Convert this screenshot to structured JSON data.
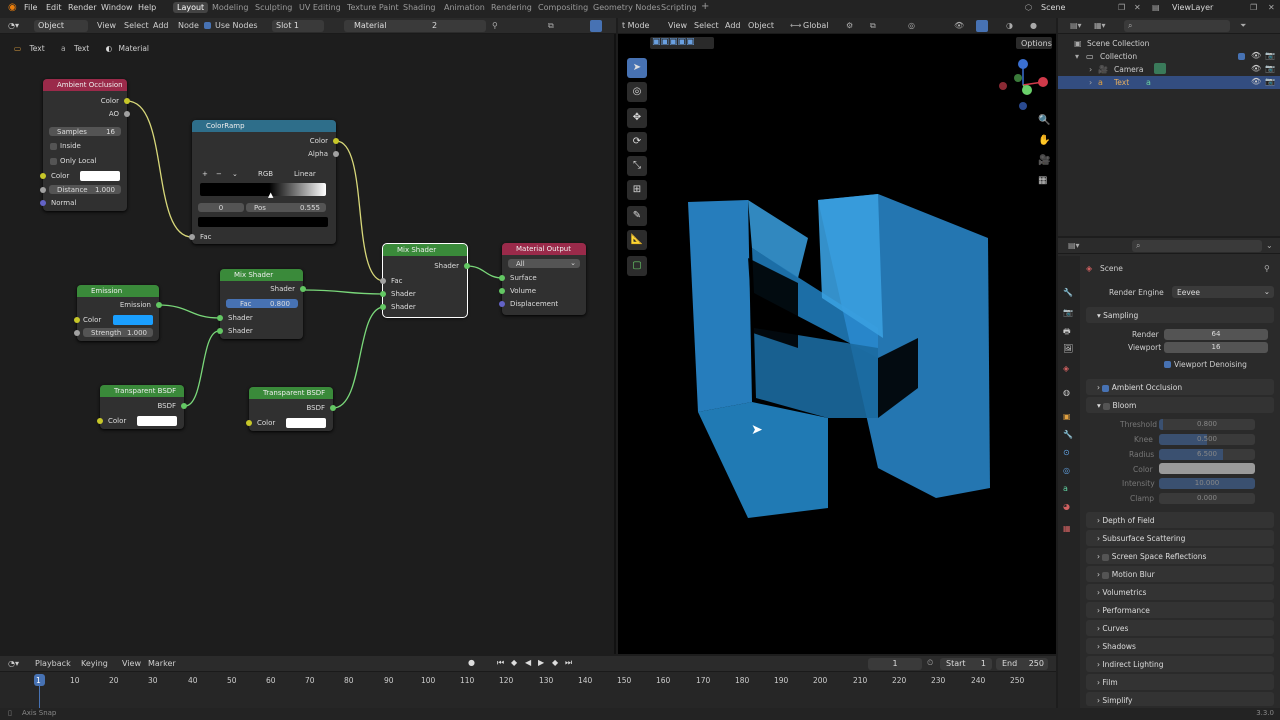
{
  "menu": [
    "File",
    "Edit",
    "Render",
    "Window",
    "Help"
  ],
  "workspaces": [
    "Layout",
    "Modeling",
    "Sculpting",
    "UV Editing",
    "Texture Paint",
    "Shading",
    "Animation",
    "Rendering",
    "Compositing",
    "Geometry Nodes",
    "Scripting"
  ],
  "scene_name": "Scene",
  "view_layer": "ViewLayer",
  "node_header": {
    "mode": "Object",
    "view": "View",
    "select": "Select",
    "add": "Add",
    "node": "Node",
    "use_nodes": "Use Nodes",
    "slot": "Slot 1",
    "material": "Material",
    "users": "2"
  },
  "breadcrumb": [
    "Text",
    "Text",
    "Material"
  ],
  "nodes": {
    "ao": {
      "title": "Ambient Occlusion",
      "color_out": "Color",
      "ao_out": "AO",
      "samples_label": "Samples",
      "samples": "16",
      "inside": "Inside",
      "only_local": "Only Local",
      "color_in": "Color",
      "distance_label": "Distance",
      "distance": "1.000",
      "normal": "Normal"
    },
    "ramp": {
      "title": "ColorRamp",
      "color_out": "Color",
      "alpha_out": "Alpha",
      "mode": "RGB",
      "interp": "Linear",
      "index": "0",
      "pos_label": "Pos",
      "pos": "0.555",
      "fac": "Fac"
    },
    "emission": {
      "title": "Emission",
      "out": "Emission",
      "color": "Color",
      "strength_label": "Strength",
      "strength": "1.000"
    },
    "mix1": {
      "title": "Mix Shader",
      "out": "Shader",
      "fac_label": "Fac",
      "fac": "0.800",
      "shader1": "Shader",
      "shader2": "Shader"
    },
    "mix2": {
      "title": "Mix Shader",
      "out": "Shader",
      "fac": "Fac",
      "shader1": "Shader",
      "shader2": "Shader"
    },
    "output": {
      "title": "Material Output",
      "target": "All",
      "surface": "Surface",
      "volume": "Volume",
      "displacement": "Displacement"
    },
    "tbsdf1": {
      "title": "Transparent BSDF",
      "out": "BSDF",
      "color": "Color"
    },
    "tbsdf2": {
      "title": "Transparent BSDF",
      "out": "BSDF",
      "color": "Color"
    }
  },
  "viewport_header": {
    "mode": "t Mode",
    "view": "View",
    "select": "Select",
    "add": "Add",
    "object": "Object",
    "orientation": "Global",
    "options": "Options"
  },
  "outliner": {
    "root": "Scene Collection",
    "collection": "Collection",
    "items": [
      "Camera",
      "Text"
    ]
  },
  "properties": {
    "scene": "Scene",
    "render_engine_label": "Render Engine",
    "render_engine": "Eevee",
    "sampling": "Sampling",
    "render_label": "Render",
    "render": "64",
    "viewport_label": "Viewport",
    "viewport": "16",
    "denoise": "Viewport Denoising",
    "ao": "Ambient Occlusion",
    "bloom": "Bloom",
    "threshold_label": "Threshold",
    "threshold": "0.800",
    "knee_label": "Knee",
    "knee": "0.500",
    "radius_label": "Radius",
    "radius": "6.500",
    "color_label": "Color",
    "intensity_label": "Intensity",
    "intensity": "10.000",
    "clamp_label": "Clamp",
    "clamp": "0.000",
    "panels": [
      "Depth of Field",
      "Subsurface Scattering",
      "Screen Space Reflections",
      "Motion Blur",
      "Volumetrics",
      "Performance",
      "Curves",
      "Shadows",
      "Indirect Lighting",
      "Film",
      "Simplify"
    ]
  },
  "timeline": {
    "playback": "Playback",
    "keying": "Keying",
    "view": "View",
    "marker": "Marker",
    "current": "1",
    "start_label": "Start",
    "start": "1",
    "end_label": "End",
    "end": "250",
    "ticks": [
      "1",
      "10",
      "20",
      "30",
      "40",
      "50",
      "60",
      "70",
      "80",
      "90",
      "100",
      "110",
      "120",
      "130",
      "140",
      "150",
      "160",
      "170",
      "180",
      "190",
      "200",
      "210",
      "220",
      "230",
      "240",
      "250"
    ]
  },
  "status": {
    "left": "Axis Snap",
    "version": "3.3.0"
  },
  "colors": {
    "accent": "#4772b3",
    "emission": "#1a9fff",
    "object": "#2a8bd0"
  }
}
